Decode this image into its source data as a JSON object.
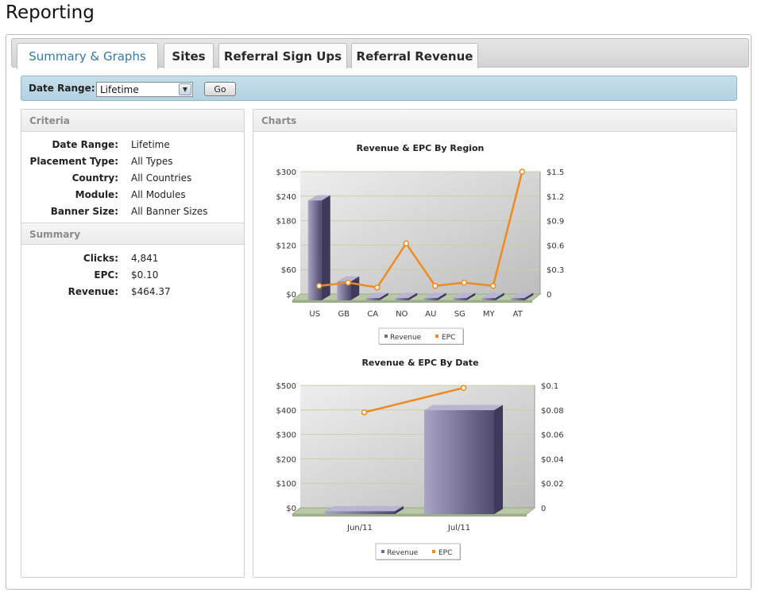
{
  "page_title": "Reporting",
  "tabs": [
    {
      "label": "Summary & Graphs",
      "active": true
    },
    {
      "label": "Sites",
      "active": false
    },
    {
      "label": "Referral Sign Ups",
      "active": false
    },
    {
      "label": "Referral Revenue",
      "active": false
    }
  ],
  "date_range": {
    "label": "Date Range:",
    "selected": "Lifetime",
    "go_label": "Go"
  },
  "criteria": {
    "heading": "Criteria",
    "rows": [
      {
        "label": "Date Range:",
        "value": "Lifetime"
      },
      {
        "label": "Placement Type:",
        "value": "All Types"
      },
      {
        "label": "Country:",
        "value": "All Countries"
      },
      {
        "label": "Module:",
        "value": "All Modules"
      },
      {
        "label": "Banner Size:",
        "value": "All Banner Sizes"
      }
    ]
  },
  "summary": {
    "heading": "Summary",
    "rows": [
      {
        "label": "Clicks:",
        "value": "4,841"
      },
      {
        "label": "EPC:",
        "value": "$0.10"
      },
      {
        "label": "Revenue:",
        "value": "$464.37"
      }
    ]
  },
  "charts_panel": {
    "heading": "Charts"
  },
  "colors": {
    "bar": "#6f6a8f",
    "line": "#f08a1c",
    "plot_grid": "#c3d3a3",
    "floor": "#b9c9a6",
    "accent_tab": "#3678ad"
  },
  "chart_data": [
    {
      "type": "bar",
      "title": "Revenue & EPC By Region",
      "categories": [
        "US",
        "GB",
        "CA",
        "NO",
        "AU",
        "SG",
        "MY",
        "AT"
      ],
      "series": [
        {
          "name": "Revenue",
          "axis": "left",
          "values": [
            245,
            46,
            4,
            3,
            3,
            3,
            3,
            2
          ]
        },
        {
          "name": "EPC",
          "axis": "right",
          "type": "line",
          "values": [
            0.1,
            0.14,
            0.08,
            0.62,
            0.1,
            0.14,
            0.1,
            1.5
          ]
        }
      ],
      "y_left": {
        "min": 0,
        "max": 300,
        "ticks": [
          "$0",
          "$60",
          "$120",
          "$180",
          "$240",
          "$300"
        ]
      },
      "y_right": {
        "min": 0,
        "max": 1.5,
        "ticks": [
          "0",
          "$0.3",
          "$0.6",
          "$0.9",
          "$1.2",
          "$1.5"
        ]
      },
      "legend": [
        "Revenue",
        "EPC"
      ],
      "legend_position": "bottom",
      "grid": true
    },
    {
      "type": "bar",
      "title": "Revenue & EPC By Date",
      "categories": [
        "Jun/11",
        "Jul/11"
      ],
      "series": [
        {
          "name": "Revenue",
          "axis": "left",
          "values": [
            12,
            425
          ]
        },
        {
          "name": "EPC",
          "axis": "right",
          "type": "line",
          "values": [
            0.078,
            0.098
          ]
        }
      ],
      "y_left": {
        "min": 0,
        "max": 500,
        "ticks": [
          "$0",
          "$100",
          "$200",
          "$300",
          "$400",
          "$500"
        ]
      },
      "y_right": {
        "min": 0,
        "max": 0.1,
        "ticks": [
          "0",
          "$0.02",
          "$0.04",
          "$0.06",
          "$0.08",
          "$0.1"
        ]
      },
      "legend": [
        "Revenue",
        "EPC"
      ],
      "legend_position": "bottom",
      "grid": true
    }
  ]
}
